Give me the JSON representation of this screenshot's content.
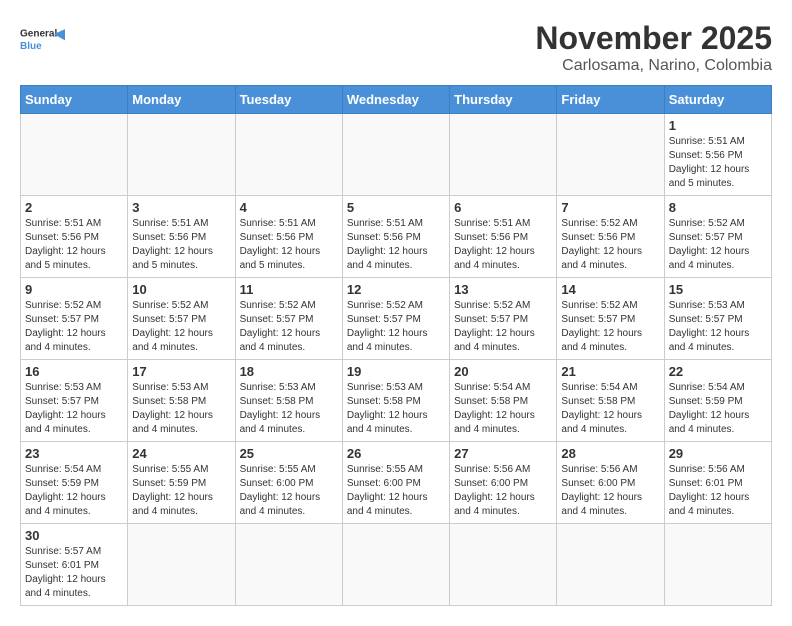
{
  "header": {
    "logo_text_general": "General",
    "logo_text_blue": "Blue",
    "month_title": "November 2025",
    "subtitle": "Carlosama, Narino, Colombia"
  },
  "weekdays": [
    "Sunday",
    "Monday",
    "Tuesday",
    "Wednesday",
    "Thursday",
    "Friday",
    "Saturday"
  ],
  "weeks": [
    [
      {
        "day": "",
        "info": ""
      },
      {
        "day": "",
        "info": ""
      },
      {
        "day": "",
        "info": ""
      },
      {
        "day": "",
        "info": ""
      },
      {
        "day": "",
        "info": ""
      },
      {
        "day": "",
        "info": ""
      },
      {
        "day": "1",
        "info": "Sunrise: 5:51 AM\nSunset: 5:56 PM\nDaylight: 12 hours\nand 5 minutes."
      }
    ],
    [
      {
        "day": "2",
        "info": "Sunrise: 5:51 AM\nSunset: 5:56 PM\nDaylight: 12 hours\nand 5 minutes."
      },
      {
        "day": "3",
        "info": "Sunrise: 5:51 AM\nSunset: 5:56 PM\nDaylight: 12 hours\nand 5 minutes."
      },
      {
        "day": "4",
        "info": "Sunrise: 5:51 AM\nSunset: 5:56 PM\nDaylight: 12 hours\nand 5 minutes."
      },
      {
        "day": "5",
        "info": "Sunrise: 5:51 AM\nSunset: 5:56 PM\nDaylight: 12 hours\nand 4 minutes."
      },
      {
        "day": "6",
        "info": "Sunrise: 5:51 AM\nSunset: 5:56 PM\nDaylight: 12 hours\nand 4 minutes."
      },
      {
        "day": "7",
        "info": "Sunrise: 5:52 AM\nSunset: 5:56 PM\nDaylight: 12 hours\nand 4 minutes."
      },
      {
        "day": "8",
        "info": "Sunrise: 5:52 AM\nSunset: 5:57 PM\nDaylight: 12 hours\nand 4 minutes."
      }
    ],
    [
      {
        "day": "9",
        "info": "Sunrise: 5:52 AM\nSunset: 5:57 PM\nDaylight: 12 hours\nand 4 minutes."
      },
      {
        "day": "10",
        "info": "Sunrise: 5:52 AM\nSunset: 5:57 PM\nDaylight: 12 hours\nand 4 minutes."
      },
      {
        "day": "11",
        "info": "Sunrise: 5:52 AM\nSunset: 5:57 PM\nDaylight: 12 hours\nand 4 minutes."
      },
      {
        "day": "12",
        "info": "Sunrise: 5:52 AM\nSunset: 5:57 PM\nDaylight: 12 hours\nand 4 minutes."
      },
      {
        "day": "13",
        "info": "Sunrise: 5:52 AM\nSunset: 5:57 PM\nDaylight: 12 hours\nand 4 minutes."
      },
      {
        "day": "14",
        "info": "Sunrise: 5:52 AM\nSunset: 5:57 PM\nDaylight: 12 hours\nand 4 minutes."
      },
      {
        "day": "15",
        "info": "Sunrise: 5:53 AM\nSunset: 5:57 PM\nDaylight: 12 hours\nand 4 minutes."
      }
    ],
    [
      {
        "day": "16",
        "info": "Sunrise: 5:53 AM\nSunset: 5:57 PM\nDaylight: 12 hours\nand 4 minutes."
      },
      {
        "day": "17",
        "info": "Sunrise: 5:53 AM\nSunset: 5:58 PM\nDaylight: 12 hours\nand 4 minutes."
      },
      {
        "day": "18",
        "info": "Sunrise: 5:53 AM\nSunset: 5:58 PM\nDaylight: 12 hours\nand 4 minutes."
      },
      {
        "day": "19",
        "info": "Sunrise: 5:53 AM\nSunset: 5:58 PM\nDaylight: 12 hours\nand 4 minutes."
      },
      {
        "day": "20",
        "info": "Sunrise: 5:54 AM\nSunset: 5:58 PM\nDaylight: 12 hours\nand 4 minutes."
      },
      {
        "day": "21",
        "info": "Sunrise: 5:54 AM\nSunset: 5:58 PM\nDaylight: 12 hours\nand 4 minutes."
      },
      {
        "day": "22",
        "info": "Sunrise: 5:54 AM\nSunset: 5:59 PM\nDaylight: 12 hours\nand 4 minutes."
      }
    ],
    [
      {
        "day": "23",
        "info": "Sunrise: 5:54 AM\nSunset: 5:59 PM\nDaylight: 12 hours\nand 4 minutes."
      },
      {
        "day": "24",
        "info": "Sunrise: 5:55 AM\nSunset: 5:59 PM\nDaylight: 12 hours\nand 4 minutes."
      },
      {
        "day": "25",
        "info": "Sunrise: 5:55 AM\nSunset: 6:00 PM\nDaylight: 12 hours\nand 4 minutes."
      },
      {
        "day": "26",
        "info": "Sunrise: 5:55 AM\nSunset: 6:00 PM\nDaylight: 12 hours\nand 4 minutes."
      },
      {
        "day": "27",
        "info": "Sunrise: 5:56 AM\nSunset: 6:00 PM\nDaylight: 12 hours\nand 4 minutes."
      },
      {
        "day": "28",
        "info": "Sunrise: 5:56 AM\nSunset: 6:00 PM\nDaylight: 12 hours\nand 4 minutes."
      },
      {
        "day": "29",
        "info": "Sunrise: 5:56 AM\nSunset: 6:01 PM\nDaylight: 12 hours\nand 4 minutes."
      }
    ],
    [
      {
        "day": "30",
        "info": "Sunrise: 5:57 AM\nSunset: 6:01 PM\nDaylight: 12 hours\nand 4 minutes."
      },
      {
        "day": "",
        "info": ""
      },
      {
        "day": "",
        "info": ""
      },
      {
        "day": "",
        "info": ""
      },
      {
        "day": "",
        "info": ""
      },
      {
        "day": "",
        "info": ""
      },
      {
        "day": "",
        "info": ""
      }
    ]
  ]
}
